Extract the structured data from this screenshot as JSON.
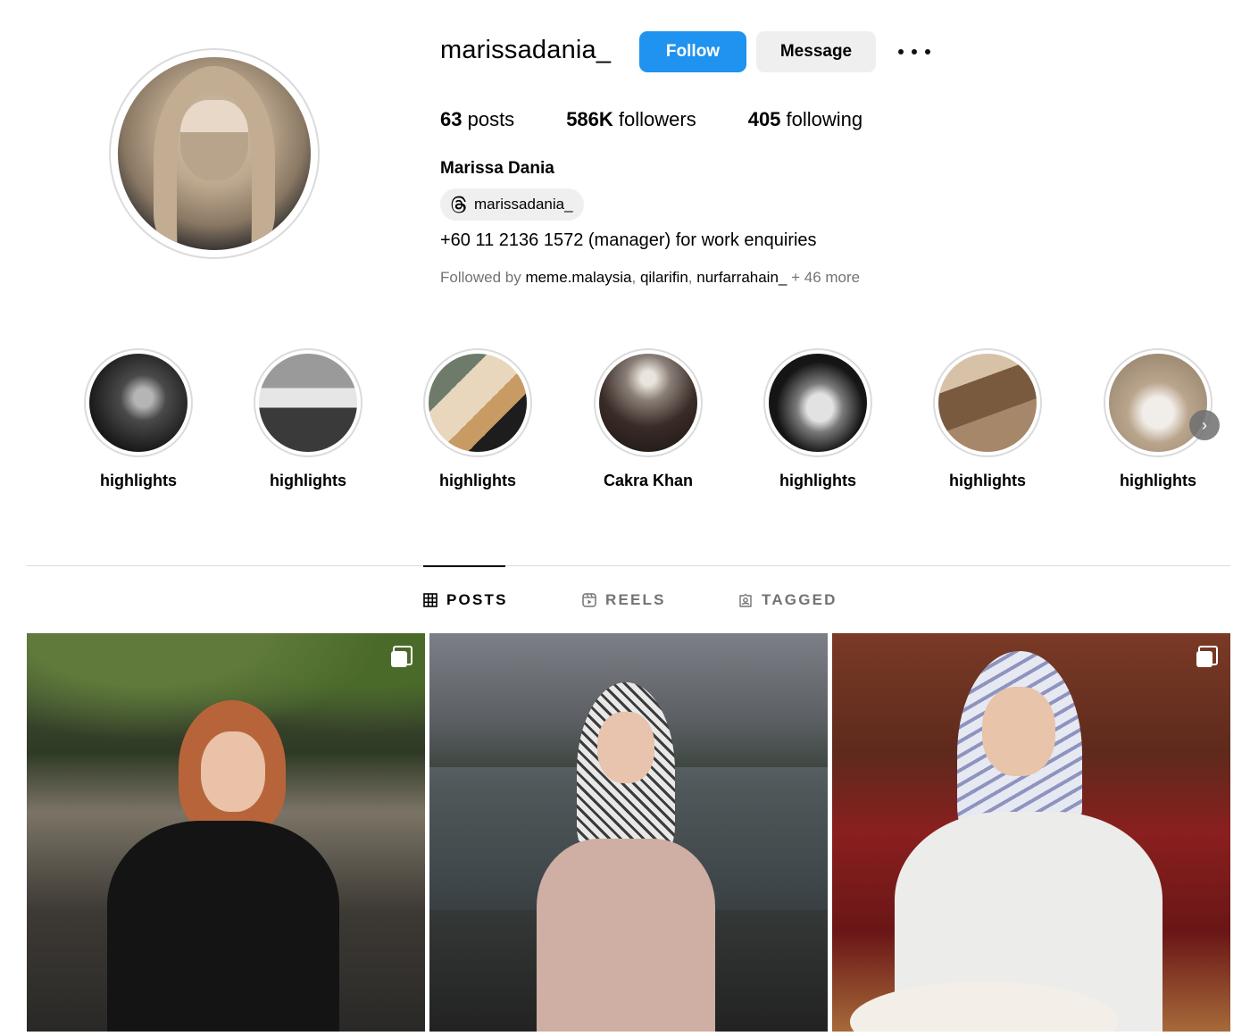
{
  "profile": {
    "username": "marissadania_",
    "follow_label": "Follow",
    "message_label": "Message",
    "stats": {
      "posts_count": "63",
      "posts_label": " posts",
      "followers_count": "586K",
      "followers_label": " followers",
      "following_count": "405",
      "following_label": " following"
    },
    "full_name": "Marissa Dania",
    "threads_handle": "marissadania_",
    "bio": "+60 11 2136 1572 (manager) for work enquiries",
    "followed_by": {
      "prefix": "Followed by ",
      "accounts": [
        "meme.malaysia",
        "qilarifin",
        "nurfarrahain_"
      ],
      "more": " + 46 more"
    }
  },
  "highlights": [
    {
      "label": "highlights"
    },
    {
      "label": "highlights"
    },
    {
      "label": "highlights"
    },
    {
      "label": "Cakra Khan"
    },
    {
      "label": "highlights"
    },
    {
      "label": "highlights"
    },
    {
      "label": "highlights"
    }
  ],
  "tabs": [
    {
      "label": "POSTS",
      "active": true
    },
    {
      "label": "REELS",
      "active": false
    },
    {
      "label": "TAGGED",
      "active": false
    }
  ],
  "colors": {
    "follow_button": "#1f93ef",
    "secondary_button": "#efefef",
    "muted_text": "#737373",
    "divider": "#dbdbdb"
  },
  "icons": [
    "more-options-icon",
    "threads-icon",
    "grid-icon",
    "reels-icon",
    "tagged-icon",
    "carousel-icon",
    "chevron-right-icon"
  ]
}
